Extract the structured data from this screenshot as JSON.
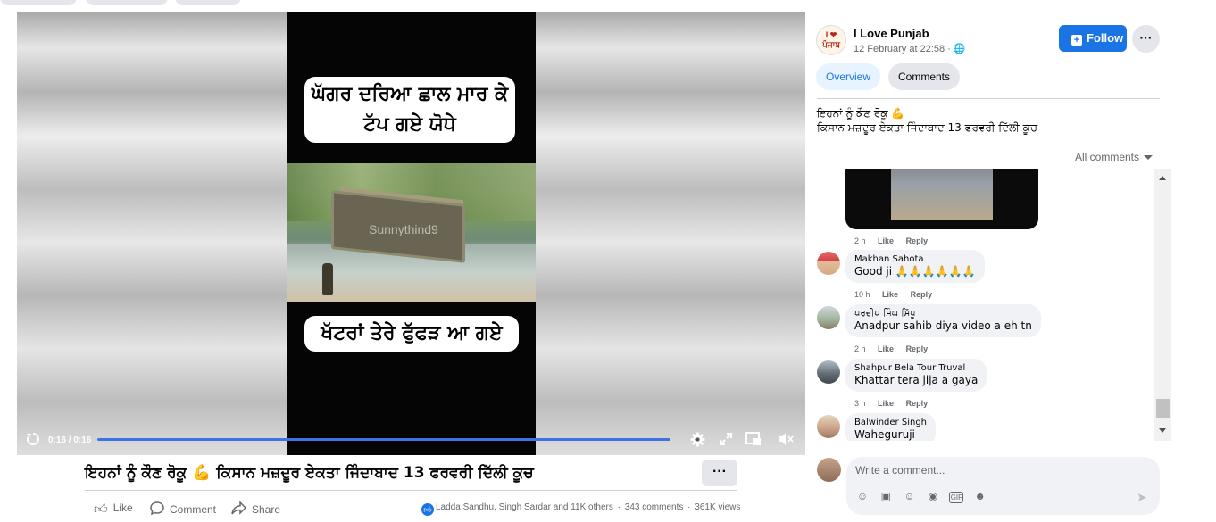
{
  "video": {
    "caption_top": "ਘੱਗਰ ਦਰਿਆ ਛਾਲ ਮਾਰ ਕੇ ਟੱਪ ਗਏ ਯੋਧੇ",
    "caption_bottom": "ਖੱਟਰਾਂ ਤੇਰੇ ਫੁੱਫੜ ਆ ਗਏ",
    "watermark": "Sunnythind9",
    "time": "0:16 / 0:16",
    "progress_fraction": 1.0
  },
  "post": {
    "title": "ਇਹਨਾਂ ਨੂੰ ਕੌਣ ਰੋਕੂ 💪 ਕਿਸਾਨ ਮਜ਼ਦੂਰ ਏਕਤਾ ਜਿੰਦਾਬਾਦ 13 ਫਰਵਰੀ ਦਿੱਲੀ ਕੂਚ",
    "more": "···",
    "actions": {
      "like": "Like",
      "comment": "Comment",
      "share": "Share"
    },
    "reactions_text": "Ladda Sandhu, Singh Sardar and 11K others",
    "comments_count": "343 comments",
    "views": "361K views"
  },
  "page": {
    "avatar_text": "I ❤ ਪੰਜਾਬ",
    "name": "I Love Punjab",
    "date": "12 February at 22:58 · 🌐",
    "follow_label": "Follow",
    "more": "···"
  },
  "tabs": {
    "overview": "Overview",
    "comments": "Comments"
  },
  "description": {
    "line1": "ਇਹਨਾਂ ਨੂੰ ਕੌਣ ਰੋਕੂ 💪",
    "line2": "ਕਿਸਾਨ ਮਜ਼ਦੂਰ ਏਕਤਾ ਜਿੰਦਾਬਾਦ 13 ਫਰਵਰੀ ਦਿੱਲੀ ਕੂਚ"
  },
  "comments_filter": "All comments",
  "comments": [
    {
      "name": "",
      "text": "",
      "time": "2 h",
      "like": "Like",
      "reply": "Reply"
    },
    {
      "name": "Makhan Sahota",
      "text": "Good ji 🙏🙏🙏🙏🙏🙏",
      "time": "10 h",
      "like": "Like",
      "reply": "Reply"
    },
    {
      "name": "ਪਰਦੀਪ ਸਿੰਘ ਸਿੱਧੂ",
      "text": "Anadpur sahib diya video a eh tn",
      "time": "2 h",
      "like": "Like",
      "reply": "Reply"
    },
    {
      "name": "Shahpur Bela Tour Truval",
      "text": "Khattar tera jija a gaya",
      "time": "3 h",
      "like": "Like",
      "reply": "Reply"
    },
    {
      "name": "Balwinder Singh",
      "text": "Waheguruji",
      "time": "",
      "like": "",
      "reply": ""
    }
  ],
  "composer": {
    "placeholder": "Write a comment..."
  },
  "colors": {
    "accent": "#1b74e4",
    "bubble": "#f0f2f5",
    "muted": "#65676b"
  }
}
